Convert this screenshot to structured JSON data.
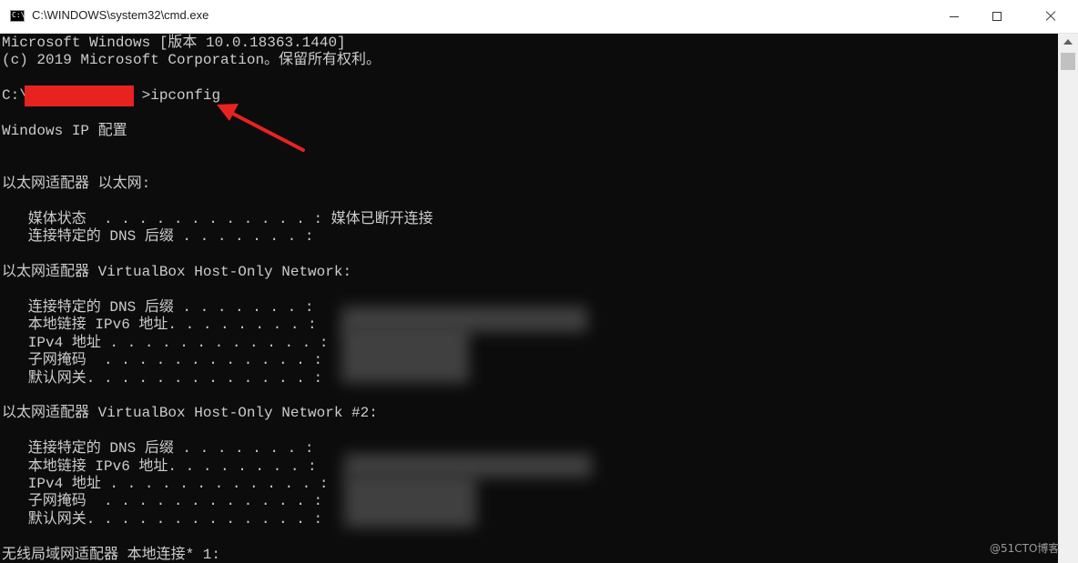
{
  "window": {
    "title": "C:\\WINDOWS\\system32\\cmd.exe",
    "icon": "cmd-icon",
    "icon_glyph": "C:\\",
    "controls": [
      "minimize-icon",
      "maximize-icon",
      "close-icon"
    ]
  },
  "console": {
    "lines": [
      "Microsoft Windows [版本 10.0.18363.1440]",
      "(c) 2019 Microsoft Corporation。保留所有权利。",
      "",
      "C:\\             >ipconfig",
      "",
      "Windows IP 配置",
      "",
      "",
      "以太网适配器 以太网:",
      "",
      "   媒体状态  . . . . . . . . . . . . : 媒体已断开连接",
      "   连接特定的 DNS 后缀 . . . . . . . :",
      "",
      "以太网适配器 VirtualBox Host-Only Network:",
      "",
      "   连接特定的 DNS 后缀 . . . . . . . :",
      "   本地链接 IPv6 地址. . . . . . . . :",
      "   IPv4 地址 . . . . . . . . . . . . :",
      "   子网掩码  . . . . . . . . . . . . :",
      "   默认网关. . . . . . . . . . . . . :",
      "",
      "以太网适配器 VirtualBox Host-Only Network #2:",
      "",
      "   连接特定的 DNS 后缀 . . . . . . . :",
      "   本地链接 IPv6 地址. . . . . . . . :",
      "   IPv4 地址 . . . . . . . . . . . . :",
      "   子网掩码  . . . . . . . . . . . . :",
      "   默认网关. . . . . . . . . . . . . :",
      "",
      "无线局域网适配器 本地连接* 1:"
    ],
    "colors": {
      "background": "#0c0c0c",
      "text": "#cccccc",
      "annotation": "#e8231f"
    }
  },
  "watermark": "@51CTO博客"
}
